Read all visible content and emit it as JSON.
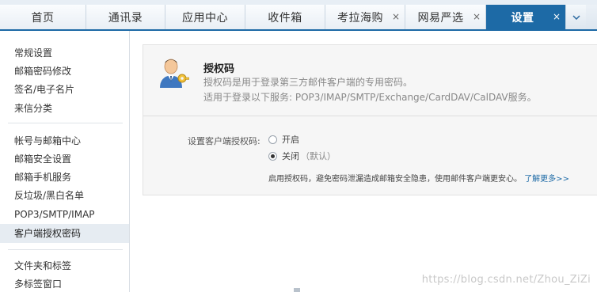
{
  "tabs": [
    {
      "label": "首页",
      "closable": false,
      "active": false
    },
    {
      "label": "通讯录",
      "closable": false,
      "active": false
    },
    {
      "label": "应用中心",
      "closable": false,
      "active": false
    },
    {
      "label": "收件箱",
      "closable": false,
      "active": false
    },
    {
      "label": "考拉海购",
      "closable": true,
      "active": false
    },
    {
      "label": "网易严选",
      "closable": true,
      "active": false
    },
    {
      "label": "设置",
      "closable": true,
      "active": true
    }
  ],
  "tab_close_glyph": "×",
  "sidebar": {
    "items": [
      "常规设置",
      "邮箱密码修改",
      "签名/电子名片",
      "来信分类",
      "帐号与邮箱中心",
      "邮箱安全设置",
      "邮箱手机服务",
      "反垃圾/黑白名单",
      "POP3/SMTP/IMAP",
      "客户端授权密码",
      "文件夹和标签",
      "多标签窗口"
    ],
    "active_index": 9
  },
  "auth": {
    "title": "授权码",
    "description": "授权码是用于登录第三方邮件客户端的专用密码。",
    "services": "适用于登录以下服务: POP3/IMAP/SMTP/Exchange/CardDAV/CalDAV服务。"
  },
  "setting": {
    "label": "设置客户端授权码:",
    "option_on": "开启",
    "option_off": "关闭",
    "option_off_note": "（默认）",
    "selected": "off",
    "hint": "启用授权码，避免密码泄漏造成邮箱安全隐患，使用邮件客户端更安心。",
    "learn_more": "了解更多>>"
  },
  "watermark": "https://blog.csdn.net/Zhou_ZiZi",
  "colors": {
    "accent": "#1d6aa6",
    "active_sidebar_bg": "#e6ecf2",
    "panel_bg": "#f6f6f6"
  },
  "icons": {
    "user_key": "user-key-icon",
    "more_tabs": "chevron-down-icon"
  }
}
